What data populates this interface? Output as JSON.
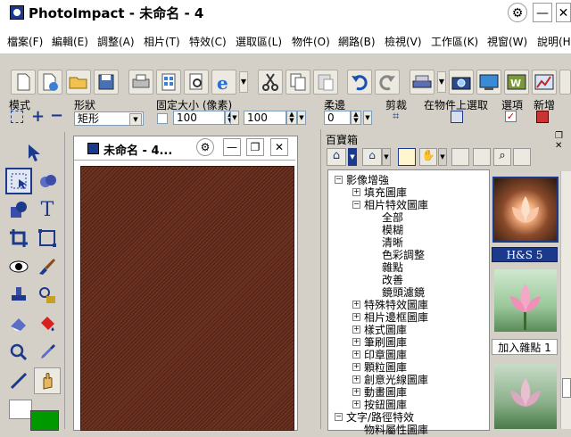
{
  "window": {
    "title": "PhotoImpact - 未命名 - 4"
  },
  "menu": [
    "檔案(F)",
    "編輯(E)",
    "調整(A)",
    "相片(T)",
    "特效(C)",
    "選取區(L)",
    "物件(O)",
    "網路(B)",
    "檢視(V)",
    "工作區(K)",
    "視窗(W)",
    "說明(H)"
  ],
  "attrbar": {
    "mode_label": "模式",
    "shape_label": "形狀",
    "shape_value": "矩形",
    "fixed_size_label": "固定大小 (像素)",
    "width_value": "100",
    "height_value": "100",
    "soft_edge_label": "柔邊",
    "soft_edge_value": "0",
    "crop_label": "剪裁",
    "select_on_object_label": "在物件上選取",
    "options_label": "選項",
    "new_label": "新增"
  },
  "document": {
    "title": "未命名 - 4..."
  },
  "palette": {
    "title": "百寶箱",
    "tree": [
      "影像增強",
      "填充圖庫",
      "相片特效圖庫",
      "全部",
      "模糊",
      "清晰",
      "色彩調整",
      "雜點",
      "改善",
      "鏡頭濾鏡",
      "特殊特效圖庫",
      "相片邊框圖庫",
      "樣式圖庫",
      "筆刷圖庫",
      "印章圖庫",
      "顆粒圖庫",
      "創意光線圖庫",
      "動畫圖庫",
      "按鈕圖庫",
      "文字/路徑特效",
      "物料屬性圖庫"
    ],
    "thumbs": [
      {
        "label": "H&S 5",
        "selected": true
      },
      {
        "label": "加入雜點 1",
        "selected": false
      },
      {
        "label": "",
        "selected": false
      }
    ]
  },
  "colors": {
    "foreground": "#ffffff",
    "background": "#009900",
    "accent": "#1b3a8c"
  }
}
